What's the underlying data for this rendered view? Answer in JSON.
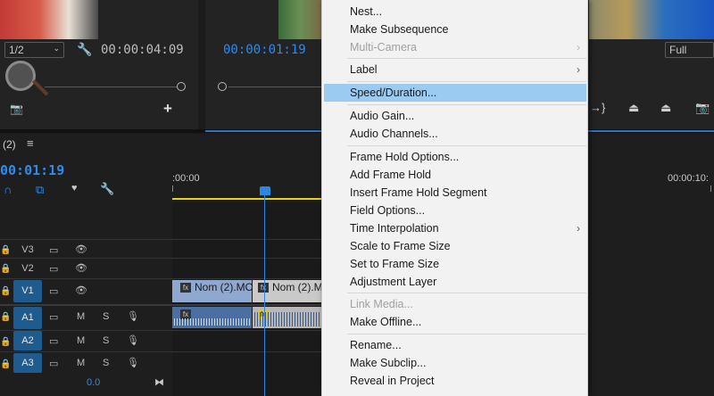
{
  "source_monitor": {
    "zoom_select": "1/2",
    "timecode": "00:00:04:09",
    "add_icon": "plus-icon"
  },
  "program_monitor": {
    "timecode": "00:00:01:19",
    "quality_select": "Full"
  },
  "timeline": {
    "sequence_tab": "(2)",
    "playhead_timecode": "00:01:19",
    "ruler_start": ":00:00",
    "ruler_end": "00:00:10:",
    "tracks": [
      {
        "label": "V3",
        "active": false
      },
      {
        "label": "V2",
        "active": false
      },
      {
        "label": "V1",
        "active": true
      },
      {
        "label": "A1",
        "active": true
      },
      {
        "label": "A2",
        "active": true
      },
      {
        "label": "A3",
        "active": true
      }
    ],
    "audio_m": "M",
    "audio_s": "S",
    "master_volume": "0.0",
    "clips": {
      "v1_clip_1": "Nom (2).MO",
      "v1_clip_2": "Nom (2).M",
      "fx_label": "fx"
    }
  },
  "context_menu": {
    "items": [
      {
        "label": "Nest...",
        "enabled": true
      },
      {
        "label": "Make Subsequence",
        "enabled": true
      },
      {
        "label": "Multi-Camera",
        "enabled": false,
        "submenu": true
      },
      {
        "label": "Label",
        "enabled": true,
        "submenu": true
      },
      {
        "label": "Speed/Duration...",
        "enabled": true,
        "highlighted": true
      },
      {
        "label": "Audio Gain...",
        "enabled": true
      },
      {
        "label": "Audio Channels...",
        "enabled": true
      },
      {
        "label": "Frame Hold Options...",
        "enabled": true
      },
      {
        "label": "Add Frame Hold",
        "enabled": true
      },
      {
        "label": "Insert Frame Hold Segment",
        "enabled": true
      },
      {
        "label": "Field Options...",
        "enabled": true
      },
      {
        "label": "Time Interpolation",
        "enabled": true,
        "submenu": true
      },
      {
        "label": "Scale to Frame Size",
        "enabled": true
      },
      {
        "label": "Set to Frame Size",
        "enabled": true
      },
      {
        "label": "Adjustment Layer",
        "enabled": true
      },
      {
        "label": "Link Media...",
        "enabled": false
      },
      {
        "label": "Make Offline...",
        "enabled": true
      },
      {
        "label": "Rename...",
        "enabled": true
      },
      {
        "label": "Make Subclip...",
        "enabled": true
      },
      {
        "label": "Reveal in Project",
        "enabled": true
      }
    ],
    "submenu_arrow": "›"
  },
  "colors": {
    "accent_blue": "#2d8ceb",
    "highlight": "#9ccbf2",
    "playhead_marker": "#2f86e0",
    "work_area": "#e8d21a"
  }
}
